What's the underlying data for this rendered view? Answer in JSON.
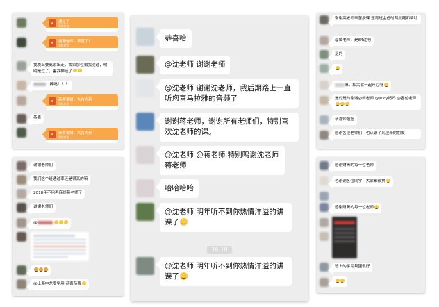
{
  "panel1": {
    "envelopes": [
      {
        "title": "通过了",
        "sub": "领取红包"
      },
      {
        "title": "谢谢老师，辛苦了！",
        "sub": "领取红包"
      }
    ],
    "msg_pass": "我晚上要离家出走，我家那位骗我没过，明明是过了，害我神经了",
    "msg_thanks": "！棒哒！！！",
    "envelopes2": [
      {
        "title": "恭喜发财，大吉大利",
        "sub": "领取红包"
      },
      {
        "title": "恭喜发财，大吉大利",
        "sub": "领取红包"
      }
    ],
    "msg_congrats": "恭喜"
  },
  "panel2": {
    "messages": [
      "谢谢老师们",
      "我们这个班通过率还是很高的嘛",
      "2018年不用再麻烦蒋老师了",
      "谢谢老师们",
      "@上海申龙度学用 恭喜恭喜"
    ],
    "mini_at": "@"
  },
  "panel3": {
    "timestamp": "16:10",
    "messages": [
      "恭喜哈",
      "@沈老师 谢谢老师",
      "@沈老师 谢谢沈老师，我后期路上一直听您喜马拉雅的音频了",
      "谢谢蒋老师，谢谢所有老师们，特别喜欢沈老师的课。",
      "@沈老师 @蒋老师 特别鸣谢沈老师蒋老师",
      "哈哈哈哈",
      "@沈老师 明年听不到你热情洋溢的讲课了",
      "@沈老师 明年听不到你热情洋溢的讲课了"
    ]
  },
  "panel4": {
    "messages": [
      "谢谢高老师辛苦授课 还有班主任时刻提醒和帮助",
      "@姬老师，是84过吧",
      "是的",
      "嗯，和大家一起开心呀",
      "是的是的谢谢@姬老师 @Juicy妈妈 @各位老师",
      "恭喜师姐姐",
      "感谢各位老师们，也认识了几位新的朋友"
    ]
  },
  "panel5": {
    "messages": [
      "感谢财菁的每一位老师",
      "也谢谢各位同学，大家都很拼",
      "感谢财菁的每一位老师",
      "班上的学习氛围很好"
    ]
  },
  "colors": {
    "chat_bg": "#ededed",
    "bubble": "#ffffff",
    "red_packet": "#f8a74a"
  }
}
